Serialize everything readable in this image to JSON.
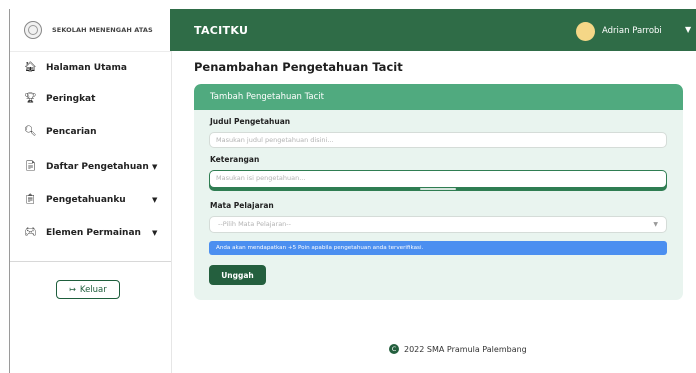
{
  "sidebar": {
    "brand": "SEKOLAH MENENGAH ATAS",
    "items": [
      {
        "label": "Halaman Utama",
        "icon": "home-icon",
        "glyph": "🏠︎",
        "caret": ""
      },
      {
        "label": "Peringkat",
        "icon": "trophy-icon",
        "glyph": "🏆︎",
        "caret": ""
      },
      {
        "label": "Pencarian",
        "icon": "search-icon",
        "glyph": "🔍︎",
        "caret": ""
      },
      {
        "label": "Daftar Pengetahuan",
        "icon": "document-icon",
        "glyph": "📄︎",
        "caret": "▼"
      },
      {
        "label": "Pengetahuanku",
        "icon": "clipboard-icon",
        "glyph": "📋︎",
        "caret": "▼"
      },
      {
        "label": "Elemen Permainan",
        "icon": "gamepad-icon",
        "glyph": "🎮︎",
        "caret": "▼"
      }
    ],
    "logout_icon": "↦",
    "logout_label": "Keluar"
  },
  "header": {
    "app_title": "TACITKU",
    "user_name": "Adrian Parrobi",
    "user_caret": "▼",
    "avatar_color": "#f5d787"
  },
  "main": {
    "page_title": "Penambahan Pengetahuan Tacit",
    "card": {
      "title": "Tambah Pengetahuan Tacit",
      "title_label": "Judul Pengetahuan",
      "title_placeholder": "Masukan judul pengetahuan disini...",
      "desc_label": "Keterangan",
      "desc_placeholder": "Masukan isi pengetahuan...",
      "subject_label": "Mata Pelajaran",
      "subject_selected": "--Pilih Mata Pelajaran--",
      "info": "Anda akan mendapatkan +5 Poin apabila pengetahuan anda terverifikasi.",
      "submit_label": "Unggah"
    }
  },
  "footer": {
    "copyright_symbol": "C",
    "text": "2022 SMA Pramula Palembang"
  },
  "colors": {
    "header_green": "#2f6c47",
    "card_header_green": "#50aa7f",
    "card_bg": "#e9f4ef",
    "button_green": "#245f3e",
    "info_blue": "#4c8ff0"
  }
}
